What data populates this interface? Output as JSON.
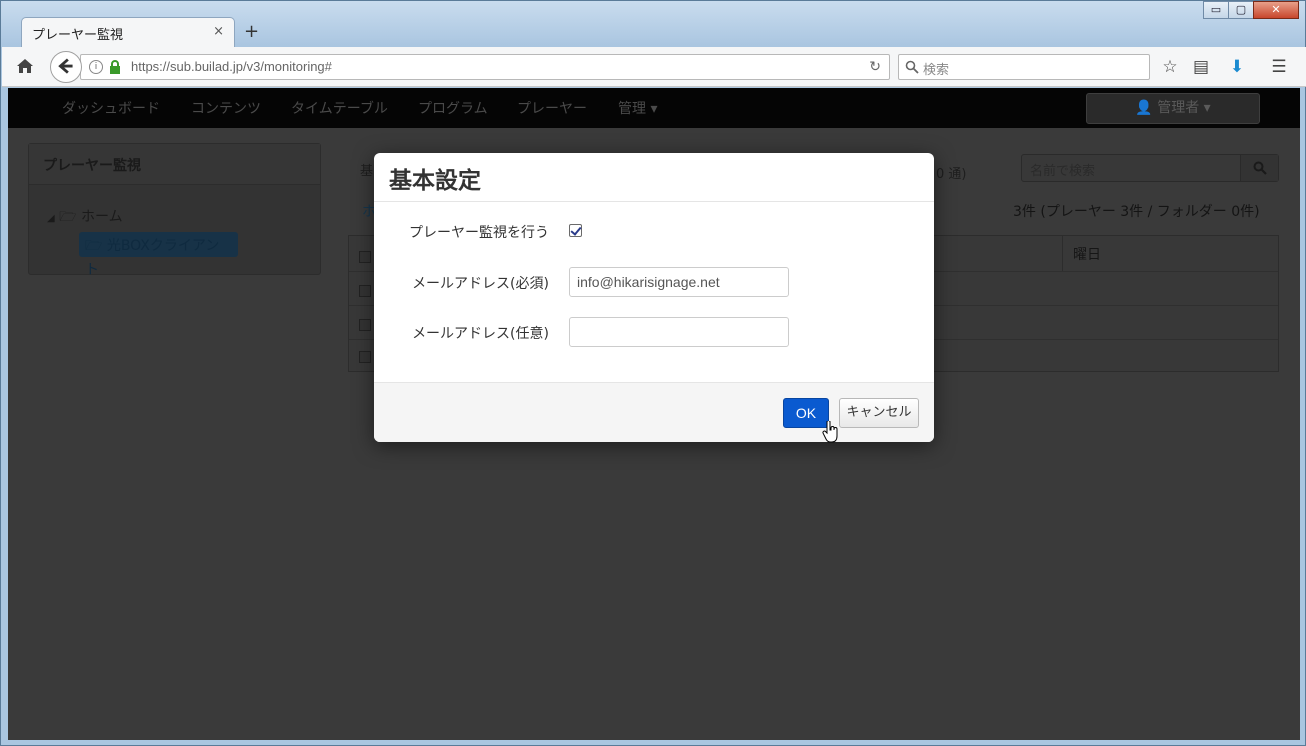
{
  "browser": {
    "tab_title": "プレーヤー監視",
    "tab_close": "×",
    "new_tab": "+",
    "window_controls": {
      "minimize": "▭",
      "maximize": "▢",
      "close": "✕"
    },
    "url": "https://sub.builad.jp/v3/monitoring#",
    "search_placeholder": "検索",
    "toolbar_icons": [
      "bookmark-star-icon",
      "reading-list-icon",
      "download-icon",
      "menu-icon"
    ]
  },
  "app_nav": {
    "items": [
      "ダッシュボード",
      "コンテンツ",
      "タイムテーブル",
      "プログラム",
      "プレーヤー",
      "管理 ▾"
    ],
    "user": "管理者 ▾"
  },
  "left_panel": {
    "title": "プレーヤー監視",
    "tree": {
      "root": "ホーム",
      "child": "光BOXクライアント"
    }
  },
  "main": {
    "search_placeholder": "名前で検索",
    "count": "3件 (プレーヤー 3件 / フォルダー 0件)",
    "behind_button": "基",
    "behind_link": "ホ",
    "behind_status": "0 通)",
    "column_header": "曜日"
  },
  "modal": {
    "title": "基本設定",
    "monitor_label": "プレーヤー監視を行う",
    "monitor_checked": true,
    "email_required_label": "メールアドレス(必須)",
    "email_required_value": "info@hikarisignage.net",
    "email_optional_label": "メールアドレス(任意)",
    "email_optional_value": "",
    "ok_label": "OK",
    "cancel_label": "キャンセル"
  },
  "colors": {
    "primary": "#0a5ad0",
    "navbar": "#050505",
    "overlay": "#3a3a3a"
  }
}
